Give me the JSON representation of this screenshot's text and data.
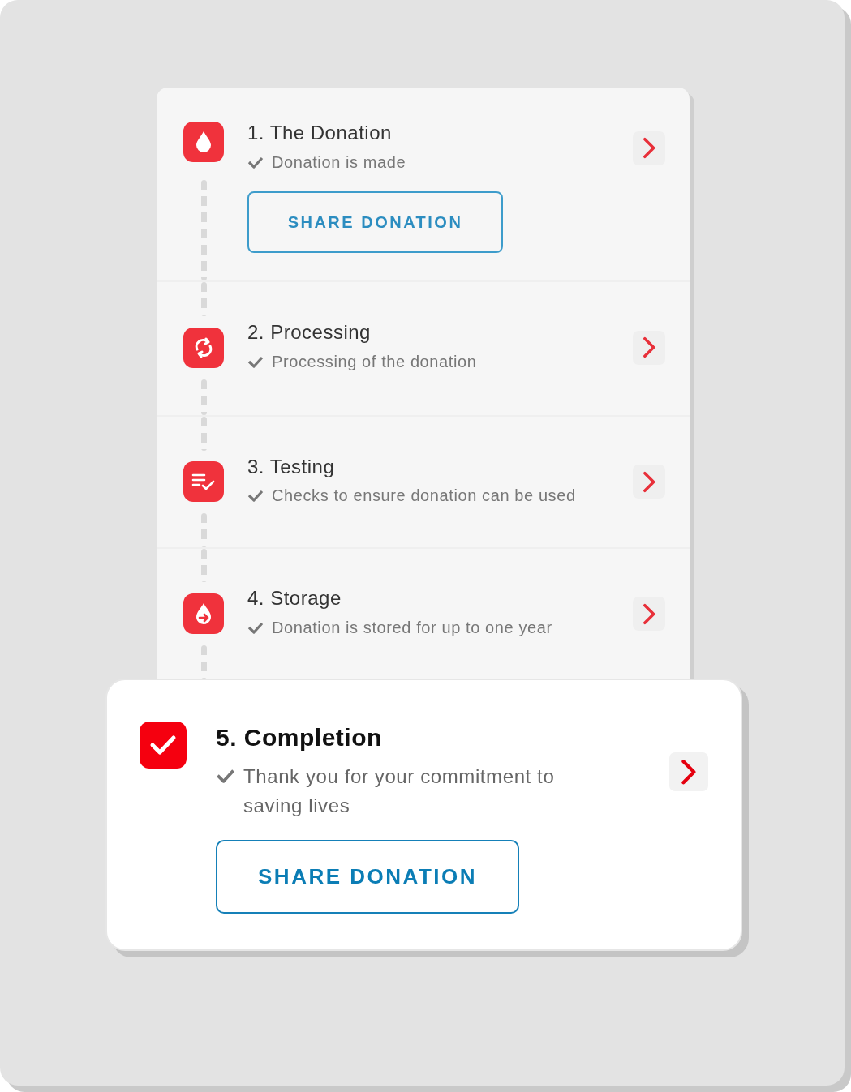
{
  "steps": [
    {
      "title": "1. The Donation",
      "description": "Donation is made",
      "button": "SHARE DONATION",
      "selected": false
    },
    {
      "title": "2. Processing",
      "description": "Processing of the donation",
      "selected": false
    },
    {
      "title": "3. Testing",
      "description": "Checks to ensure donation can be used",
      "selected": false
    },
    {
      "title": "4. Storage",
      "description": "Donation is stored for up to one year",
      "selected": false
    },
    {
      "title": "5. Completion",
      "description": "Thank you for your commitment to saving lives",
      "button": "SHARE DONATION",
      "selected": true
    }
  ]
}
